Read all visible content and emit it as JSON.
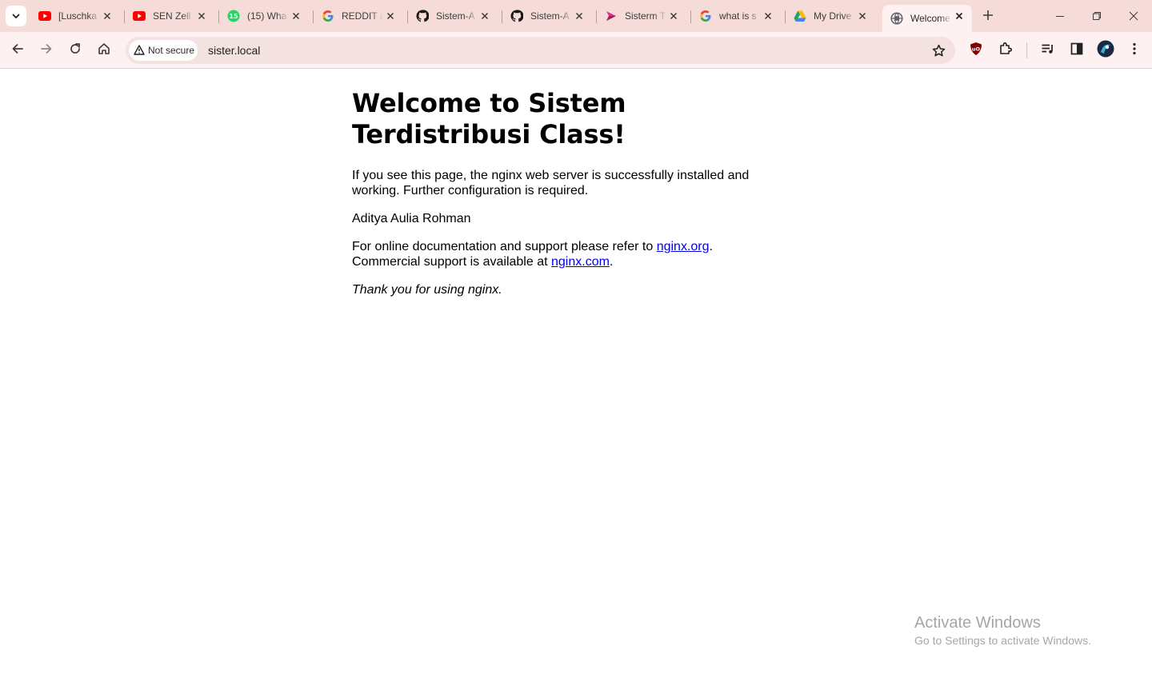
{
  "browser": {
    "tabs": [
      {
        "title": "[Luschka",
        "favicon": "youtube-icon",
        "color": "#ff0000"
      },
      {
        "title": "SEN Zell",
        "favicon": "youtube-icon",
        "color": "#ff0000"
      },
      {
        "title": "(15) Wha",
        "favicon": "whatsapp-icon",
        "color": "#25d366"
      },
      {
        "title": "REDDIT a",
        "favicon": "google-icon",
        "color": "#4285f4"
      },
      {
        "title": "Sistem-A",
        "favicon": "github-icon",
        "color": "#181717"
      },
      {
        "title": "Sistem-A",
        "favicon": "github-icon",
        "color": "#181717"
      },
      {
        "title": "Sisterm T",
        "favicon": "app-icon",
        "color": "#d6338b"
      },
      {
        "title": "what is s",
        "favicon": "google-icon",
        "color": "#4285f4"
      },
      {
        "title": "My Drive",
        "favicon": "google-drive-icon",
        "color": "#1fa463"
      },
      {
        "title": "Welcome",
        "favicon": "globe-icon",
        "color": "#5f6368"
      }
    ],
    "security_label": "Not secure",
    "url": "sister.local"
  },
  "page": {
    "heading": "Welcome to Sistem Terdistribusi Class!",
    "intro": "If you see this page, the nginx web server is successfully installed and working. Further configuration is required.",
    "author": "Aditya Aulia Rohman",
    "docs_prefix": "For online documentation and support please refer to ",
    "docs_link": "nginx.org",
    "docs_mid": ".",
    "commercial_prefix": "Commercial support is available at ",
    "commercial_link": "nginx.com",
    "commercial_suffix": ".",
    "thanks": "Thank you for using nginx."
  },
  "watermark": {
    "title": "Activate Windows",
    "subtitle": "Go to Settings to activate Windows."
  },
  "colors": {
    "tabstrip": "#f6dcd9",
    "toolbar": "#fdf2f1",
    "link": "#0000ee"
  }
}
